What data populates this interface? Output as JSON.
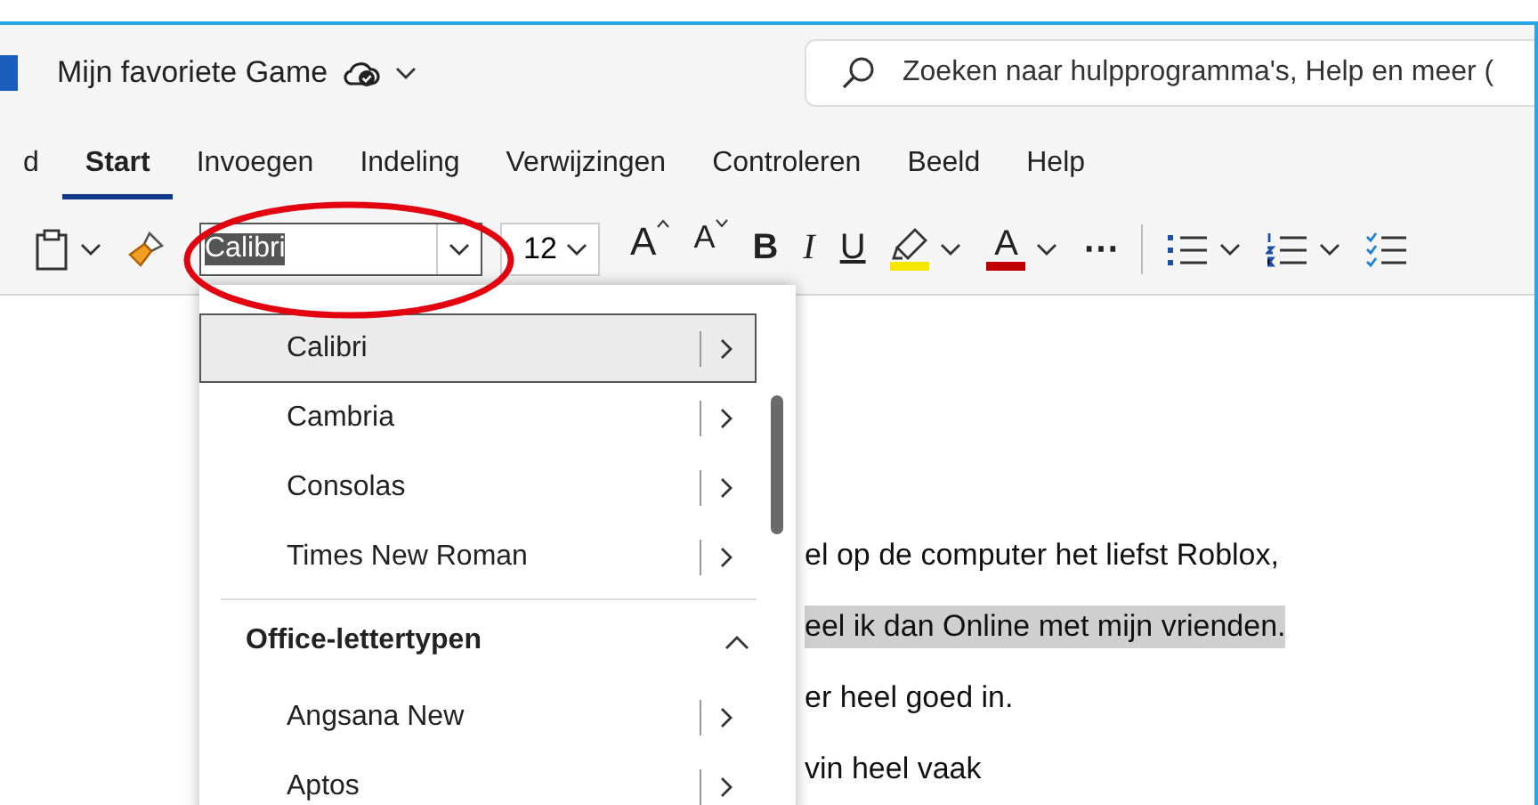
{
  "window": {
    "title": "Mijn favoriete Game"
  },
  "search": {
    "placeholder": "Zoeken naar hulpprogramma's, Help en meer ("
  },
  "tabs": [
    {
      "label": "d",
      "selected": false
    },
    {
      "label": "Start",
      "selected": true
    },
    {
      "label": "Invoegen",
      "selected": false
    },
    {
      "label": "Indeling",
      "selected": false
    },
    {
      "label": "Verwijzingen",
      "selected": false
    },
    {
      "label": "Controleren",
      "selected": false
    },
    {
      "label": "Beeld",
      "selected": false
    },
    {
      "label": "Help",
      "selected": false
    }
  ],
  "toolbar": {
    "font": {
      "value": "Calibri",
      "text_selected": true
    },
    "size": {
      "value": "12"
    },
    "format_buttons": [
      {
        "kind": "grow",
        "label": "A",
        "dropdown": false
      },
      {
        "kind": "shrink",
        "label": "A",
        "dropdown": false
      },
      {
        "kind": "bold",
        "label": "B",
        "dropdown": false
      },
      {
        "kind": "italic",
        "label": "I",
        "dropdown": false
      },
      {
        "kind": "underline",
        "label": "U",
        "dropdown": false
      },
      {
        "kind": "highlight",
        "color": "#f5e600",
        "dropdown": true
      },
      {
        "kind": "font_color",
        "label": "A",
        "color": "#c00000",
        "dropdown": true
      },
      {
        "kind": "more",
        "label": "⋯",
        "dropdown": false
      }
    ],
    "list_buttons": [
      {
        "kind": "bullets",
        "dropdown": true
      },
      {
        "kind": "numbered",
        "dropdown": true
      },
      {
        "kind": "checklist"
      }
    ]
  },
  "font_menu": {
    "items": [
      {
        "kind": "font",
        "label": "Calibri",
        "selected": true
      },
      {
        "kind": "font",
        "label": "Cambria",
        "selected": false
      },
      {
        "kind": "font",
        "label": "Consolas",
        "selected": false
      },
      {
        "kind": "font",
        "label": "Times New Roman",
        "selected": false
      },
      {
        "kind": "header",
        "label": "Office-lettertypen",
        "expanded": true
      },
      {
        "kind": "font",
        "label": "Angsana New",
        "selected": false
      },
      {
        "kind": "font",
        "label": "Aptos",
        "selected": false
      }
    ]
  },
  "document": {
    "lines": [
      {
        "text": "el op de computer het liefst Roblox,",
        "highlighted": false
      },
      {
        "text": "eel ik dan Online met mijn vrienden.",
        "highlighted": true
      },
      {
        "text": "er heel goed in.",
        "highlighted": false
      },
      {
        "text": "vin heel vaak",
        "highlighted": false
      }
    ]
  }
}
